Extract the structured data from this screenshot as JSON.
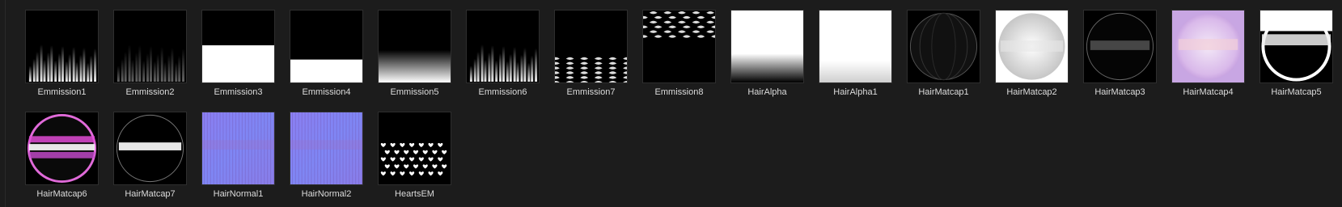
{
  "assets": [
    {
      "name": "Emmission1",
      "thumb": "emission-streaks-bottom"
    },
    {
      "name": "Emmission2",
      "thumb": "emission-streaks-faint"
    },
    {
      "name": "Emmission3",
      "thumb": "emission-white-bottom-half"
    },
    {
      "name": "Emmission4",
      "thumb": "emission-white-bottom-band"
    },
    {
      "name": "Emmission5",
      "thumb": "emission-soft-fade"
    },
    {
      "name": "Emmission6",
      "thumb": "emission-streaks-bottom"
    },
    {
      "name": "Emmission7",
      "thumb": "emission-zebra-bottom"
    },
    {
      "name": "Emmission8",
      "thumb": "emission-zebra-top"
    },
    {
      "name": "HairAlpha",
      "thumb": "alpha-white-top"
    },
    {
      "name": "HairAlpha1",
      "thumb": "alpha-white-top-full"
    },
    {
      "name": "HairMatcap1",
      "thumb": "matcap-dark-sphere"
    },
    {
      "name": "HairMatcap2",
      "thumb": "matcap-white-sphere"
    },
    {
      "name": "HairMatcap3",
      "thumb": "matcap-dark-ring"
    },
    {
      "name": "HairMatcap4",
      "thumb": "matcap-lavender"
    },
    {
      "name": "HairMatcap5",
      "thumb": "matcap-black-band"
    },
    {
      "name": "HairMatcap6",
      "thumb": "matcap-pink"
    },
    {
      "name": "HairMatcap7",
      "thumb": "matcap-black-white-band"
    },
    {
      "name": "HairNormal1",
      "thumb": "normal-map"
    },
    {
      "name": "HairNormal2",
      "thumb": "normal-map"
    },
    {
      "name": "HeartsEM",
      "thumb": "hearts"
    }
  ]
}
